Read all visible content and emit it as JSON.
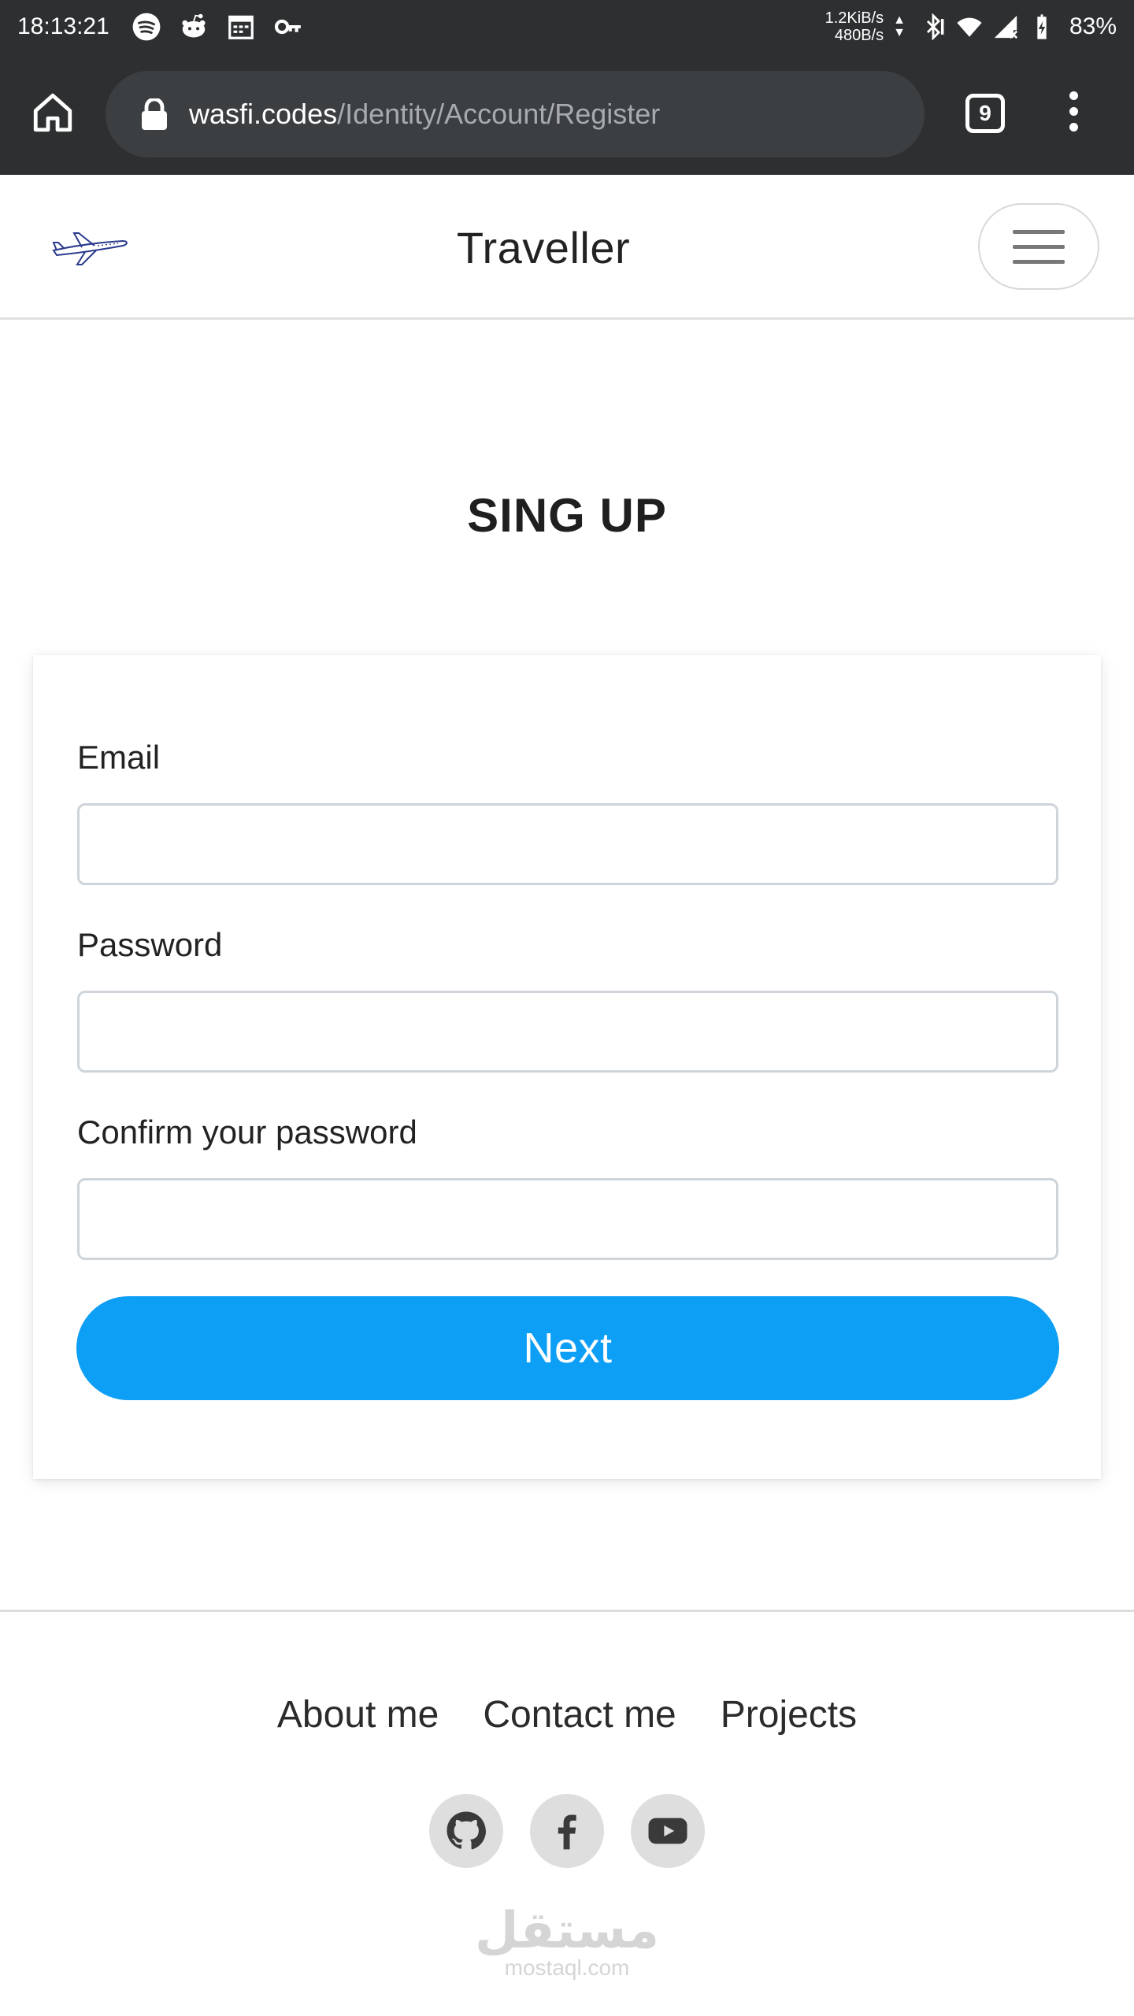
{
  "status_bar": {
    "time": "18:13:21",
    "net_up": "1.2KiB/s",
    "net_down": "480B/s",
    "battery": "83%",
    "left_icons": [
      "spotify-icon",
      "reddit-icon",
      "calendar-icon",
      "vpn-key-icon"
    ],
    "right_icons": [
      "bluetooth-icon",
      "wifi-icon",
      "cell-signal-icon",
      "battery-charging-icon"
    ]
  },
  "browser": {
    "url_host": "wasfi.codes",
    "url_path": "/Identity/Account/Register",
    "tab_count": "9"
  },
  "navbar": {
    "brand": "Traveller"
  },
  "main": {
    "title": "SING UP",
    "fields": [
      {
        "label": "Email",
        "value": "",
        "placeholder": ""
      },
      {
        "label": "Password",
        "value": "",
        "placeholder": ""
      },
      {
        "label": "Confirm your password",
        "value": "",
        "placeholder": ""
      }
    ],
    "submit_label": "Next"
  },
  "footer": {
    "links": [
      "About me",
      "Contact me",
      "Projects"
    ],
    "socials": [
      "github-icon",
      "facebook-icon",
      "youtube-icon"
    ]
  },
  "watermark": {
    "arabic": "مستقل",
    "latin": "mostaql.com"
  },
  "colors": {
    "chrome_bg": "#2d2f31",
    "url_pill": "#3c3f42",
    "primary_button": "#0d9ef5",
    "input_border": "#ced4da"
  }
}
